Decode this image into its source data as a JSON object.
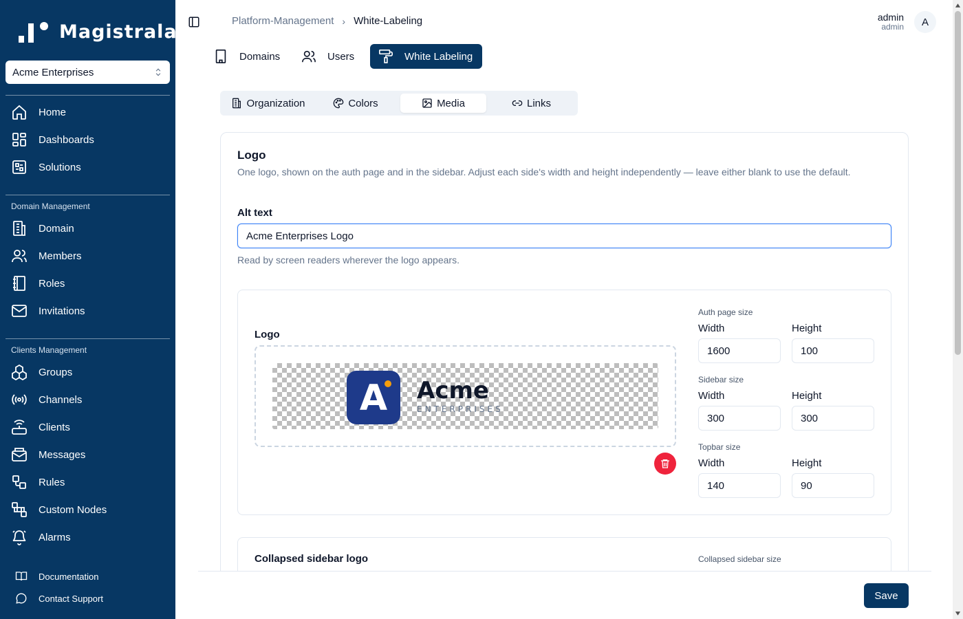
{
  "brand": {
    "name": "Magistrala",
    "sidebar_color": "#073763",
    "accent": "#073763",
    "danger": "#ef233c"
  },
  "org_selector": {
    "value": "Acme Enterprises"
  },
  "nav": {
    "main": [
      {
        "label": "Home",
        "icon": "home-icon"
      },
      {
        "label": "Dashboards",
        "icon": "dashboard-icon"
      },
      {
        "label": "Solutions",
        "icon": "solutions-icon"
      }
    ],
    "domain_section": "Domain Management",
    "domain": [
      {
        "label": "Domain",
        "icon": "building-icon"
      },
      {
        "label": "Members",
        "icon": "users-icon"
      },
      {
        "label": "Roles",
        "icon": "book-icon"
      },
      {
        "label": "Invitations",
        "icon": "mail-icon"
      }
    ],
    "clients_section": "Clients Management",
    "clients": [
      {
        "label": "Groups",
        "icon": "boxes-icon"
      },
      {
        "label": "Channels",
        "icon": "radio-icon"
      },
      {
        "label": "Clients",
        "icon": "router-icon"
      },
      {
        "label": "Messages",
        "icon": "mail-open-icon"
      },
      {
        "label": "Rules",
        "icon": "workflow-icon"
      },
      {
        "label": "Custom Nodes",
        "icon": "nodes-icon"
      },
      {
        "label": "Alarms",
        "icon": "bell-icon"
      }
    ],
    "footer": [
      {
        "label": "Documentation",
        "icon": "book-open-icon"
      },
      {
        "label": "Contact Support",
        "icon": "message-icon"
      }
    ]
  },
  "breadcrumb": {
    "parent": "Platform-Management",
    "current": "White-Labeling"
  },
  "user": {
    "name": "admin",
    "role": "admin",
    "initial": "A"
  },
  "top_tabs": [
    {
      "label": "Domains",
      "active": false
    },
    {
      "label": "Users",
      "active": false
    },
    {
      "label": "White Labeling",
      "active": true
    }
  ],
  "sub_tabs": [
    {
      "label": "Organization",
      "active": false
    },
    {
      "label": "Colors",
      "active": false
    },
    {
      "label": "Media",
      "active": true
    },
    {
      "label": "Links",
      "active": false
    }
  ],
  "logo_card": {
    "title": "Logo",
    "description": "One logo, shown on the auth page and in the sidebar. Adjust each side's width and height independently — leave either blank to use the default.",
    "alt_label": "Alt text",
    "alt_value": "Acme Enterprises Logo",
    "alt_help": "Read by screen readers wherever the logo appears.",
    "upload_label": "Logo",
    "preview": {
      "word": "Acme",
      "sub": "ENTERPRISES",
      "letter": "A"
    },
    "sizes": {
      "auth": {
        "label": "Auth page size",
        "width_label": "Width",
        "height_label": "Height",
        "width": "1600",
        "height": "100"
      },
      "sidebar": {
        "label": "Sidebar size",
        "width_label": "Width",
        "height_label": "Height",
        "width": "300",
        "height": "300"
      },
      "topbar": {
        "label": "Topbar size",
        "width_label": "Width",
        "height_label": "Height",
        "width": "140",
        "height": "90"
      }
    },
    "collapsed_label": "Collapsed sidebar logo",
    "collapsed_size_label": "Collapsed sidebar size"
  },
  "actions": {
    "save_label": "Save"
  }
}
